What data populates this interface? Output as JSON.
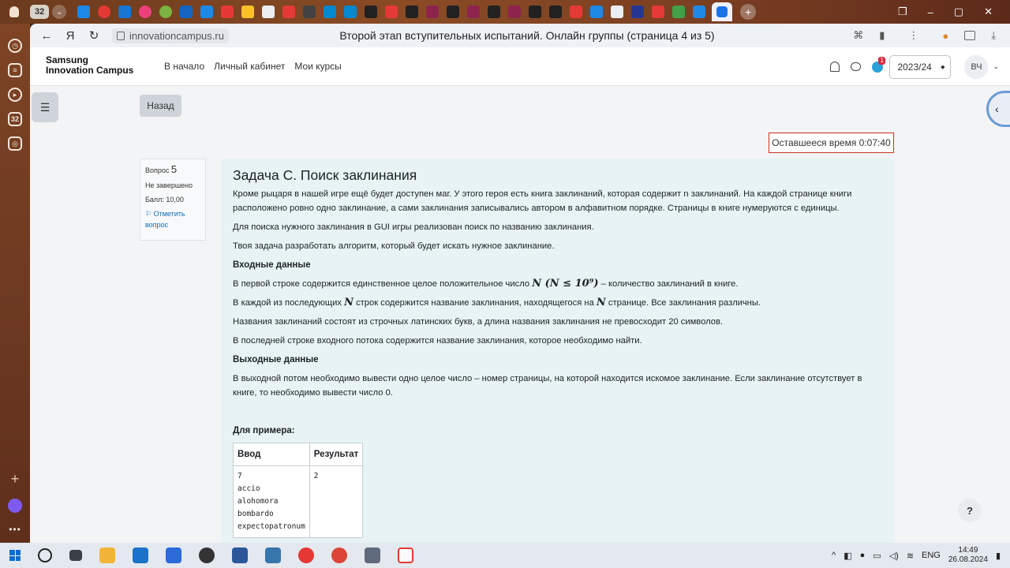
{
  "browser": {
    "tab_count": "32",
    "page_title": "Второй этап вступительных испытаний. Онлайн группы (страница 4 из 5)",
    "url_host": "innovationcampus.ru",
    "sidebar_badge": "32"
  },
  "site": {
    "logo_line1": "Samsung",
    "logo_line2": "Innovation Campus",
    "nav": [
      "В начало",
      "Личный кабинет",
      "Мои курсы"
    ],
    "year": "2023/24",
    "user_initials": "ВЧ",
    "notification_badge": "1"
  },
  "quiz": {
    "back_label": "Назад",
    "timer": "Оставшееся время 0:07:40",
    "question_label": "Вопрос",
    "question_number": "5",
    "status": "Не завершено",
    "score": "Балл: 10,00",
    "flag_label": "Отметить вопрос",
    "title": "Задача C. Поиск заклинания",
    "intro": "Кроме рыцаря в нашей игре ещё будет доступен маг. У этого героя есть книга заклинаний, которая содержит n заклинаний. На каждой странице книги расположено ровно одно заклинание, а сами заклинания записывались автором в алфавитном порядке. Страницы в книге нумеруются с единицы.",
    "p2": "Для поиска нужного заклинания в GUI игры реализован поиск по названию заклинания.",
    "p3": "Твоя задача разработать алгоритм, который будет искать нужное заклинание.",
    "input_heading": "Входные данные",
    "in1_a": "В первой строке содержится единственное целое положительное число",
    "in1_math": "N (N ≤ 10⁹)",
    "in1_b": "– количество заклинаний в книге.",
    "in2_a": "В каждой из последующих",
    "in2_math1": "N",
    "in2_b": "строк содержится название заклинания, находящегося на",
    "in2_math2": "N",
    "in2_c": "странице. Все заклинания различны.",
    "in3": "Названия заклинаний состоят из строчных латинских букв, а длина названия заклинания не превосходит 20 символов.",
    "in4": "В последней строке входного потока содержится название заклинания, которое необходимо найти.",
    "output_heading": "Выходные данные",
    "out1": "В выходной потом необходимо вывести одно целое число – номер страницы, на которой находится искомое заклинание. Если заклинание отсутствует в книге, то необходимо вывести число 0.",
    "example_heading": "Для примера:",
    "table_headers": [
      "Ввод",
      "Результат"
    ],
    "example_input": [
      "7",
      "accio",
      "alohomora",
      "bombardo",
      "expectopatronum"
    ],
    "example_output": "2"
  },
  "taskbar": {
    "lang": "ENG",
    "time": "14:49",
    "date": "26.08.2024"
  },
  "colors": {
    "question_bg": "#e7f3f5",
    "timer_border": "#ca3120",
    "link": "#0f6cbf"
  }
}
